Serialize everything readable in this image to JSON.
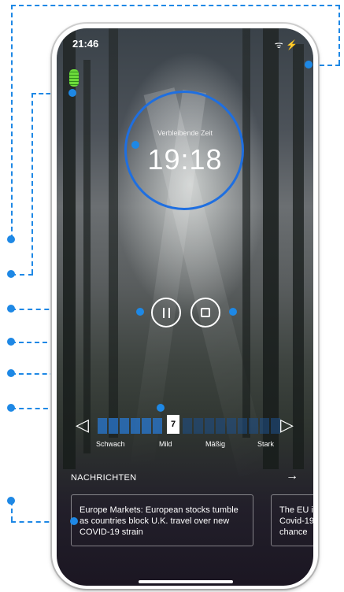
{
  "status": {
    "time": "21:46",
    "icons": "ᯤ ⚡"
  },
  "timer": {
    "label": "Verbleibende Zeit",
    "value": "19:18"
  },
  "controls": {
    "pause_icon": "pause-icon",
    "stop_icon": "stop-icon"
  },
  "intensity": {
    "selected": "7",
    "labels": [
      "Schwach",
      "Mild",
      "Mäßig",
      "Stark"
    ]
  },
  "news": {
    "header": "NACHRICHTEN",
    "arrow": "→",
    "cards": [
      {
        "text": "Europe Markets: European stocks tumble as countries block U.K. travel over new COVID-19 strain"
      },
      {
        "text": "The EU i Covid-19 chance"
      }
    ]
  },
  "colors": {
    "accent": "#1e88e5",
    "ring": "#1f6fe0"
  }
}
